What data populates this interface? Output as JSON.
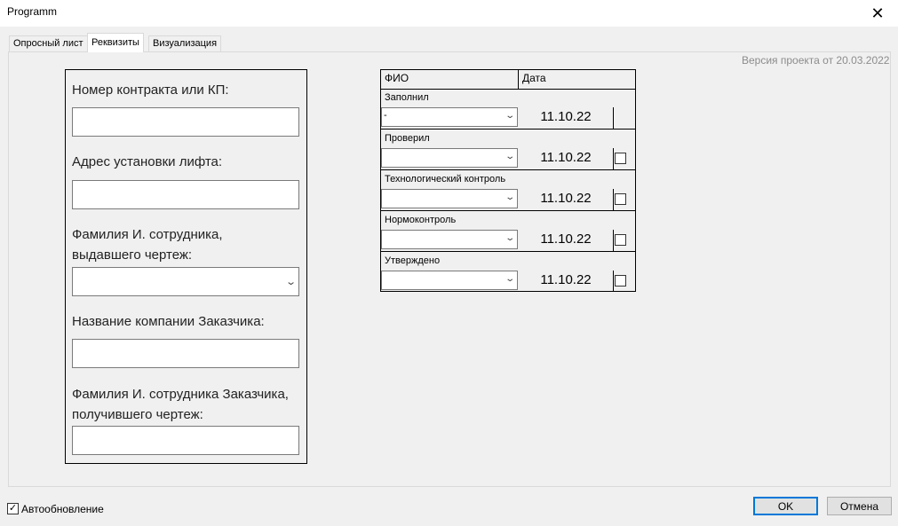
{
  "window": {
    "title": "Programm",
    "close_symbol": "✕"
  },
  "tabs": [
    {
      "label": "Опросный лист",
      "active": false
    },
    {
      "label": "Реквизиты",
      "active": true
    },
    {
      "label": "Визуализация",
      "active": false
    }
  ],
  "version_text": "Версия проекта от 20.03.2022",
  "form": {
    "contract_label": "Номер контракта или КП:",
    "contract_value": "",
    "address_label": "Адрес установки лифта:",
    "address_value": "",
    "employee_label_line1": "Фамилия И. сотрудника,",
    "employee_label_line2": "выдавшего чертеж:",
    "employee_value": "",
    "company_label": "Название компании Заказчика:",
    "company_value": "",
    "customer_employee_label_line1": "Фамилия И. сотрудника Заказчика,",
    "customer_employee_label_line2": "получившего чертеж:",
    "customer_employee_value": ""
  },
  "signatures": {
    "header_name": "ФИО",
    "header_date": "Дата",
    "rows": [
      {
        "label": "Заполнил",
        "name": "-",
        "date": "11.10.22",
        "has_checkbox": false
      },
      {
        "label": "Проверил",
        "name": "",
        "date": "11.10.22",
        "has_checkbox": true
      },
      {
        "label": "Технологический контроль",
        "name": "",
        "date": "11.10.22",
        "has_checkbox": true
      },
      {
        "label": "Нормоконтроль",
        "name": "",
        "date": "11.10.22",
        "has_checkbox": true
      },
      {
        "label": "Утверждено",
        "name": "",
        "date": "11.10.22",
        "has_checkbox": true
      }
    ]
  },
  "footer": {
    "autoupdate_label": "Автообновление",
    "autoupdate_checked": true,
    "ok_label": "OK",
    "cancel_label": "Отмена"
  },
  "colors": {
    "default_button_border": "#0078d7",
    "version_text": "#8c8c8c"
  }
}
